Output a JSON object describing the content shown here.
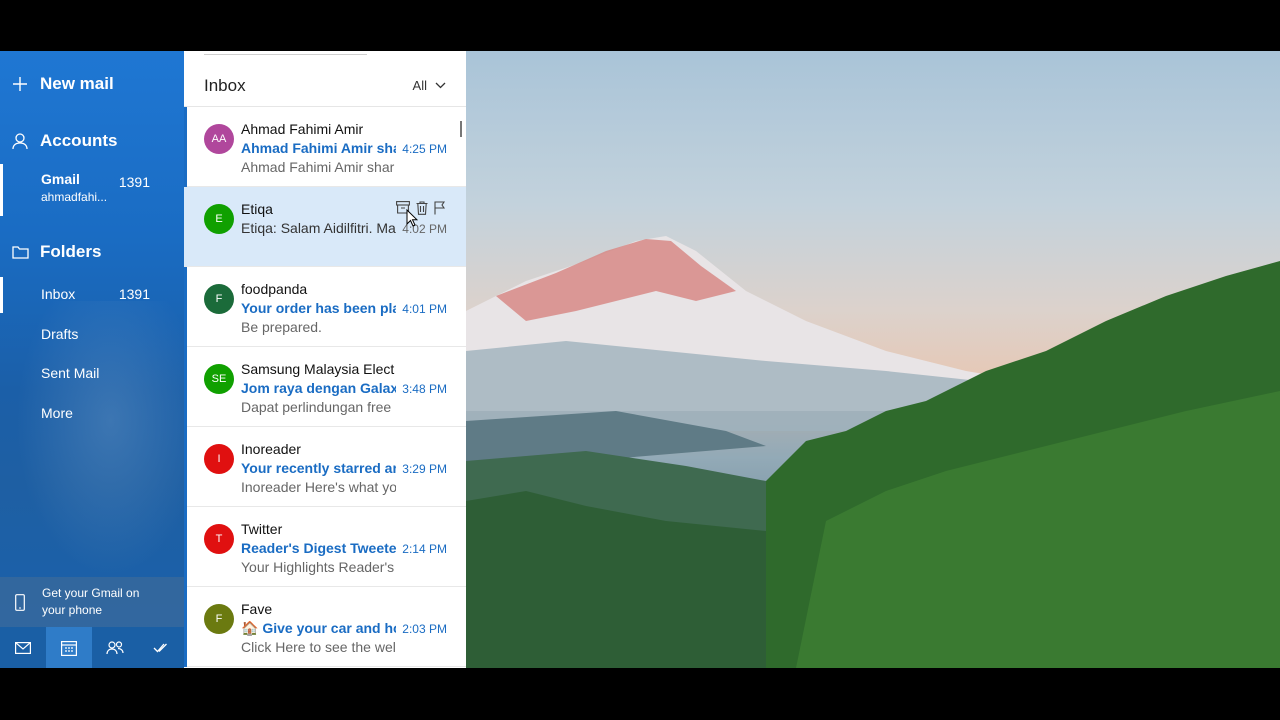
{
  "sidebar": {
    "new_mail": "New mail",
    "accounts_title": "Accounts",
    "account": {
      "name": "Gmail",
      "email": "ahmadfahi...",
      "count": "1391"
    },
    "folders_title": "Folders",
    "folders": [
      {
        "label": "Inbox",
        "count": "1391"
      },
      {
        "label": "Drafts",
        "count": ""
      },
      {
        "label": "Sent Mail",
        "count": ""
      },
      {
        "label": "More",
        "count": ""
      }
    ],
    "promo": {
      "line1": "Get your Gmail on",
      "line2": "your phone"
    },
    "bottom_nav": [
      "mail-icon",
      "calendar-icon",
      "people-icon",
      "todo-icon"
    ]
  },
  "list": {
    "title": "Inbox",
    "filter": "All",
    "messages": [
      {
        "initials": "AA",
        "color": "#b0479c",
        "sender": "Ahmad Fahimi Amir",
        "subject": "Ahmad Fahimi Amir sha",
        "preview": "Ahmad Fahimi Amir shar",
        "time": "4:25 PM",
        "unread": true
      },
      {
        "initials": "E",
        "color": "#10a000",
        "sender": "Etiqa",
        "subject": "Etiqa: Salam Aidilfitri. Ma",
        "preview": "",
        "time": "4:02 PM",
        "unread": false
      },
      {
        "initials": "F",
        "color": "#1b6b3a",
        "sender": "foodpanda",
        "subject": "Your order has been pla",
        "preview": "Be prepared.",
        "time": "4:01 PM",
        "unread": true
      },
      {
        "initials": "SE",
        "color": "#10a000",
        "sender": "Samsung Malaysia Elect",
        "subject": "Jom raya dengan Galaxy",
        "preview": "Dapat perlindungan free",
        "time": "3:48 PM",
        "unread": true
      },
      {
        "initials": "I",
        "color": "#e01010",
        "sender": "Inoreader",
        "subject": "Your recently starred art",
        "preview": "Inoreader Here's what yo",
        "time": "3:29 PM",
        "unread": true
      },
      {
        "initials": "T",
        "color": "#e01010",
        "sender": "Twitter",
        "subject": "Reader's Digest Tweetec",
        "preview": "Your Highlights Reader's",
        "time": "2:14 PM",
        "unread": true
      },
      {
        "initials": "F",
        "color": "#6b7a10",
        "sender": "Fave",
        "subject": "🏠 Give your car and ho",
        "preview": "Click Here to see the wel",
        "time": "2:03 PM",
        "unread": true
      }
    ]
  }
}
